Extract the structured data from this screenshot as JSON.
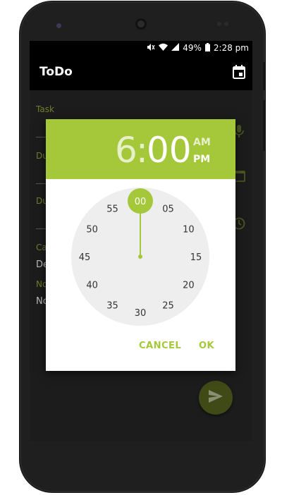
{
  "status_bar": {
    "battery": "49%",
    "time": "2:28 pm"
  },
  "app_bar": {
    "title": "ToDo",
    "action_icon": "calendar-icon"
  },
  "form": {
    "task_label": "Task",
    "due_date_label": "Du",
    "due_time_label": "Du",
    "category_label": "Ca",
    "category_value": "De",
    "notes_label": "No",
    "notes_value": "No"
  },
  "time_picker": {
    "hour": "6",
    "separator": ":",
    "minute": "00",
    "am_label": "AM",
    "pm_label": "PM",
    "selected_period": "PM",
    "selected_minute": "00",
    "dial": [
      "00",
      "05",
      "10",
      "15",
      "20",
      "25",
      "30",
      "35",
      "40",
      "45",
      "50",
      "55"
    ],
    "cancel_label": "CANCEL",
    "ok_label": "OK"
  },
  "colors": {
    "accent": "#a5c73a",
    "accent_light": "#e7f0c8",
    "dial_face": "#eeeeee",
    "scrim": "#1c1c1c"
  },
  "fab_icon": "send-icon"
}
